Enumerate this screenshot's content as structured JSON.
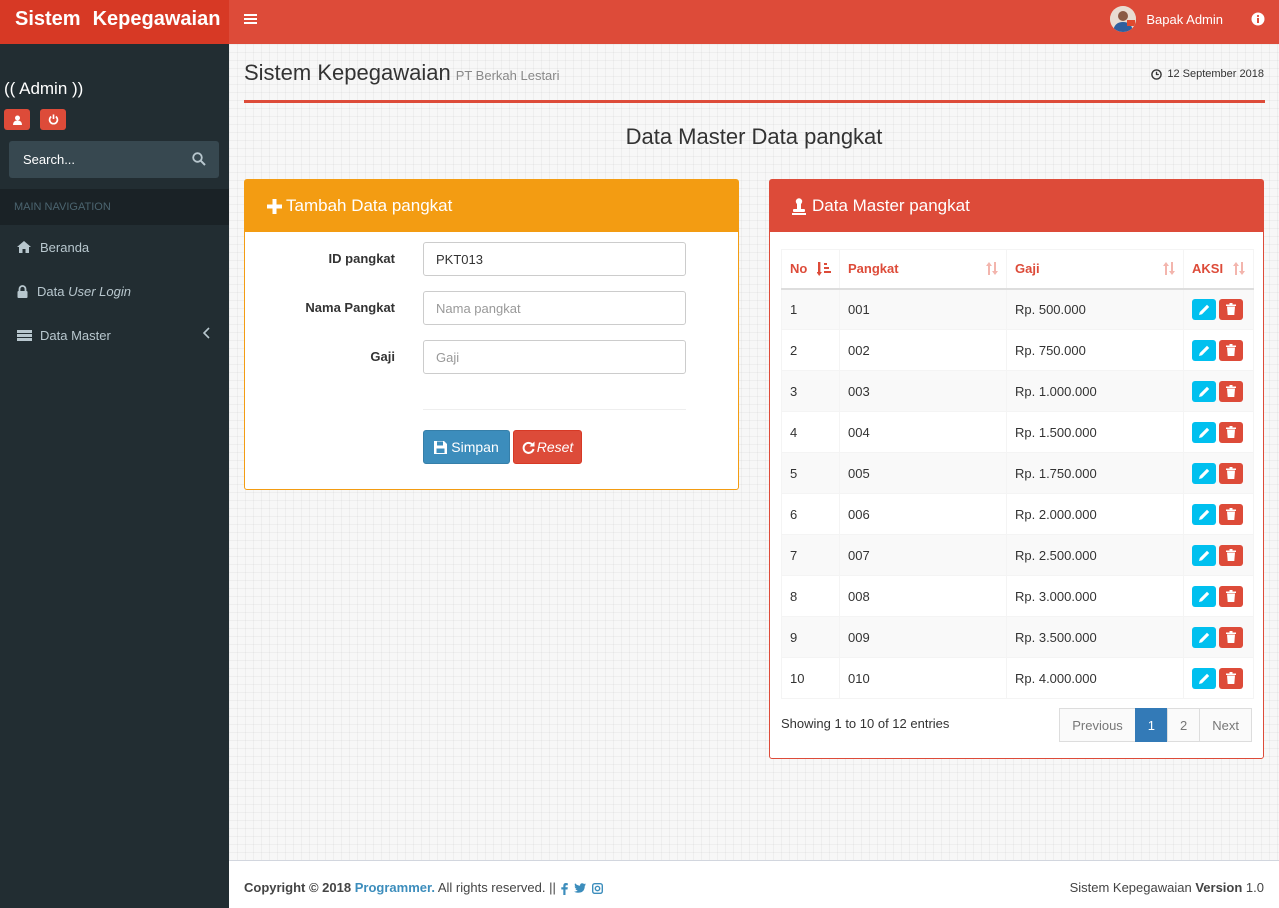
{
  "app": {
    "brand_left": "Sistem",
    "brand_right": "Kepegawaian"
  },
  "sidebar": {
    "role": "(( Admin ))",
    "search_placeholder": "Search...",
    "nav_header": "MAIN NAVIGATION",
    "items": [
      {
        "label": "Beranda",
        "icon": "home-icon"
      },
      {
        "label_plain": "Data ",
        "label_italic": "User Login",
        "icon": "lock-icon"
      },
      {
        "label": "Data Master",
        "icon": "list-icon"
      }
    ]
  },
  "topbar": {
    "user_name": "Bapak Admin"
  },
  "header": {
    "title": "Sistem Kepegawaian",
    "subtitle": "PT Berkah Lestari",
    "date": "12 September 2018"
  },
  "main_title": "Data Master Data pangkat",
  "form": {
    "title": "Tambah Data pangkat",
    "fields": [
      {
        "label": "ID pangkat",
        "value": "PKT013",
        "placeholder": ""
      },
      {
        "label": "Nama Pangkat",
        "value": "",
        "placeholder": "Nama pangkat"
      },
      {
        "label": "Gaji",
        "value": "",
        "placeholder": "Gaji"
      }
    ],
    "save_label": "Simpan",
    "reset_label": "Reset"
  },
  "table": {
    "title": "Data Master pangkat",
    "columns": [
      "No",
      "Pangkat",
      "Gaji",
      "AKSI"
    ],
    "rows": [
      [
        "1",
        "001",
        "Rp. 500.000"
      ],
      [
        "2",
        "002",
        "Rp. 750.000"
      ],
      [
        "3",
        "003",
        "Rp. 1.000.000"
      ],
      [
        "4",
        "004",
        "Rp. 1.500.000"
      ],
      [
        "5",
        "005",
        "Rp. 1.750.000"
      ],
      [
        "6",
        "006",
        "Rp. 2.000.000"
      ],
      [
        "7",
        "007",
        "Rp. 2.500.000"
      ],
      [
        "8",
        "008",
        "Rp. 3.000.000"
      ],
      [
        "9",
        "009",
        "Rp. 3.500.000"
      ],
      [
        "10",
        "010",
        "Rp. 4.000.000"
      ]
    ],
    "info": "Showing 1 to 10 of 12 entries",
    "pager": {
      "previous": "Previous",
      "page1": "1",
      "page2": "2",
      "next": "Next"
    }
  },
  "footer": {
    "copyright": "Copyright © 2018",
    "author": "Programmer.",
    "rights": "All rights reserved. ||",
    "right_text": "Sistem Kepegawaian",
    "version_label": "Version",
    "version": "1.0"
  },
  "colors": {
    "primary": "#dd4b39",
    "warning": "#f39c12",
    "info": "#00c0ef",
    "blue": "#3c8dbc",
    "sidebar": "#222d32"
  }
}
